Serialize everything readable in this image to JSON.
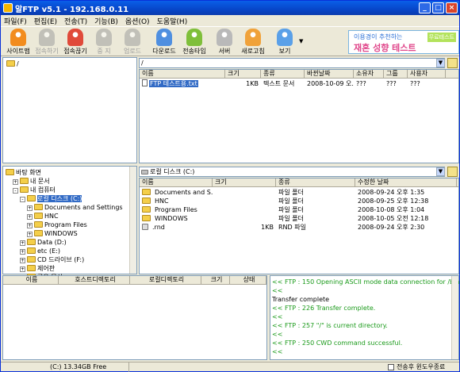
{
  "window": {
    "title": "알FTP v5.1 - 192.168.0.11"
  },
  "menu": [
    "파일(F)",
    "편집(E)",
    "전송(T)",
    "기능(B)",
    "옵션(O)",
    "도움말(H)"
  ],
  "toolbar": [
    {
      "label": "사이트맵",
      "icon": "site-map-icon",
      "color": "#f28c1e",
      "enabled": true
    },
    {
      "label": "접속하기",
      "icon": "connect-icon",
      "color": "#9aa0a6",
      "enabled": false
    },
    {
      "label": "접속끊기",
      "icon": "disconnect-icon",
      "color": "#e04a3a",
      "enabled": true
    },
    {
      "label": "중 지",
      "icon": "stop-icon",
      "color": "#9aa0a6",
      "enabled": false
    },
    {
      "label": "업로드",
      "icon": "upload-icon",
      "color": "#9aa0a6",
      "enabled": false
    },
    {
      "label": "다운로드",
      "icon": "download-icon",
      "color": "#4f8fe0",
      "enabled": true
    },
    {
      "label": "전송타입",
      "icon": "transfer-type-icon",
      "color": "#7fbf3a",
      "enabled": true
    },
    {
      "label": "서버",
      "icon": "server-icon",
      "color": "#b9b9b9",
      "enabled": true
    },
    {
      "label": "새로고침",
      "icon": "refresh-icon",
      "color": "#f0a23a",
      "enabled": true
    },
    {
      "label": "보기",
      "icon": "view-icon",
      "color": "#5aa0e8",
      "enabled": true
    }
  ],
  "banner": {
    "line1": "이용경이 추천하는",
    "line2": "재혼 성향 테스트",
    "tag": "무료테스트"
  },
  "remote": {
    "tree": [
      {
        "label": "/"
      }
    ],
    "path": "/",
    "headers": [
      "이름",
      "크기",
      "종류",
      "바뀐날짜",
      "소유자",
      "그룹",
      "사용자"
    ],
    "files": [
      {
        "name": "FTP 테스트용.txt",
        "size": "1KB",
        "type": "텍스트 문서",
        "date": "2008-10-09 오...",
        "owner": "???",
        "group": "???",
        "user": "???"
      }
    ]
  },
  "local": {
    "path": "로컬 디스크 (C:)",
    "tree": [
      {
        "label": "바탕 화면",
        "indent": 0,
        "pm": ""
      },
      {
        "label": "내 문서",
        "indent": 1,
        "pm": "+"
      },
      {
        "label": "내 컴퓨터",
        "indent": 1,
        "pm": "-"
      },
      {
        "label": "로컬 디스크 (C:)",
        "indent": 2,
        "pm": "-",
        "selected": true
      },
      {
        "label": "Documents and Settings",
        "indent": 3,
        "pm": "+"
      },
      {
        "label": "HNC",
        "indent": 3,
        "pm": "+"
      },
      {
        "label": "Program Files",
        "indent": 3,
        "pm": "+"
      },
      {
        "label": "WINDOWS",
        "indent": 3,
        "pm": "+"
      },
      {
        "label": "Data (D:)",
        "indent": 2,
        "pm": "+"
      },
      {
        "label": "etc (E:)",
        "indent": 2,
        "pm": "+"
      },
      {
        "label": "CD 드라이브 (F:)",
        "indent": 2,
        "pm": "+"
      },
      {
        "label": "제어판",
        "indent": 2,
        "pm": "+"
      },
      {
        "label": "공유 문서",
        "indent": 2,
        "pm": "+"
      }
    ],
    "headers": [
      "이름",
      "크기",
      "종류",
      "수정한 날짜"
    ],
    "files": [
      {
        "name": "Documents and S...",
        "size": "",
        "type": "파일 폴더",
        "date": "2008-09-24 오후 1:35",
        "folder": true
      },
      {
        "name": "HNC",
        "size": "",
        "type": "파일 폴더",
        "date": "2008-09-25 오후 12:38",
        "folder": true
      },
      {
        "name": "Program Files",
        "size": "",
        "type": "파일 폴더",
        "date": "2008-10-08 오후 1:04",
        "folder": true
      },
      {
        "name": "WINDOWS",
        "size": "",
        "type": "파일 폴더",
        "date": "2008-10-05 오전 12:18",
        "folder": true
      },
      {
        "name": ".rnd",
        "size": "1KB",
        "type": "RND 파일",
        "date": "2008-09-24 오후 2:30",
        "folder": false
      }
    ]
  },
  "queue": {
    "headers": [
      "이름",
      "호스트디렉토리",
      "로컬디렉토리",
      "크기",
      "상태"
    ]
  },
  "log": [
    {
      "text": "<< FTP : 150 Opening ASCII mode data connection for /bin",
      "green": true
    },
    {
      "text": "<<",
      "green": true
    },
    {
      "text": "Transfer complete",
      "green": false
    },
    {
      "text": "<< FTP : 226 Transfer complete.",
      "green": true
    },
    {
      "text": "<<",
      "green": true
    },
    {
      "text": "<< FTP : 257 \"/\" is current directory.",
      "green": true
    },
    {
      "text": "<<",
      "green": true
    },
    {
      "text": "<< FTP : 250 CWD command successful.",
      "green": true
    },
    {
      "text": "<<",
      "green": true
    }
  ],
  "status": {
    "disk": "(C:)  13.34GB Free",
    "option": "전송후 윈도우종료"
  }
}
